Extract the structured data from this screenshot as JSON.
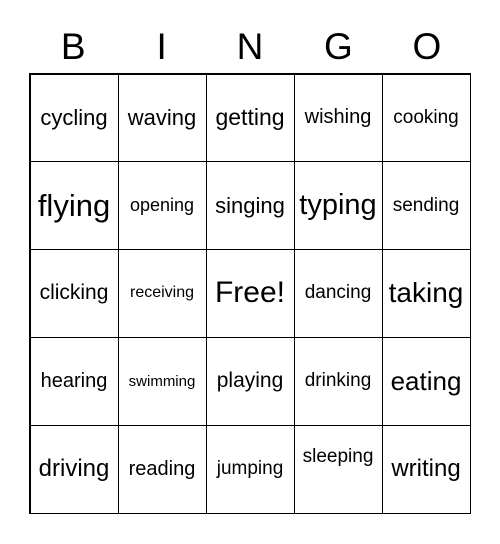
{
  "header": [
    "B",
    "I",
    "N",
    "G",
    "O"
  ],
  "rows": [
    [
      {
        "t": "cycling",
        "s": 22
      },
      {
        "t": "waving",
        "s": 22
      },
      {
        "t": "getting",
        "s": 23
      },
      {
        "t": "wishing",
        "s": 20
      },
      {
        "t": "cooking",
        "s": 19
      }
    ],
    [
      {
        "t": "flying",
        "s": 31
      },
      {
        "t": "opening",
        "s": 18
      },
      {
        "t": "singing",
        "s": 22
      },
      {
        "t": "typing",
        "s": 29
      },
      {
        "t": "sending",
        "s": 19
      }
    ],
    [
      {
        "t": "clicking",
        "s": 21
      },
      {
        "t": "receiving",
        "s": 16
      },
      {
        "t": "Free!",
        "s": 30
      },
      {
        "t": "dancing",
        "s": 19
      },
      {
        "t": "taking",
        "s": 28
      }
    ],
    [
      {
        "t": "hearing",
        "s": 20
      },
      {
        "t": "swimming",
        "s": 15
      },
      {
        "t": "playing",
        "s": 21
      },
      {
        "t": "drinking",
        "s": 19
      },
      {
        "t": "eating",
        "s": 26
      }
    ],
    [
      {
        "t": "driving",
        "s": 24
      },
      {
        "t": "reading",
        "s": 20
      },
      {
        "t": "jumping",
        "s": 19
      },
      {
        "t": "sleeping",
        "s": 19,
        "raised": true
      },
      {
        "t": "writing",
        "s": 24
      }
    ]
  ]
}
